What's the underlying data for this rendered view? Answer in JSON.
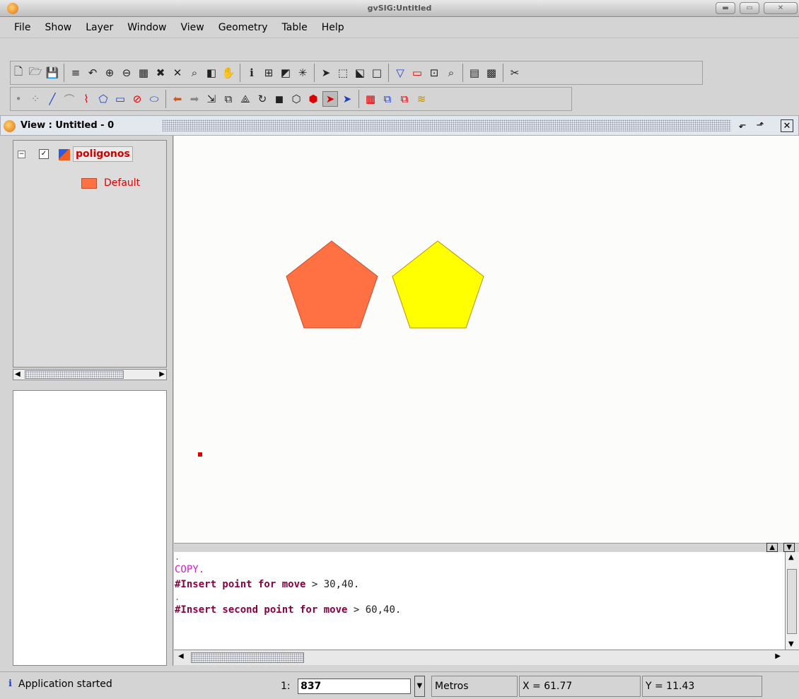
{
  "window": {
    "title": "gvSIG:Untitled"
  },
  "menu": [
    "File",
    "Show",
    "Layer",
    "Window",
    "View",
    "Geometry",
    "Table",
    "Help"
  ],
  "view": {
    "title": "View : Untitled - 0"
  },
  "toc": {
    "layer_name": "poligonos",
    "legend_label": "Default",
    "colors": {
      "layer_fill": "#ff7043",
      "layer_text": "#d00000"
    }
  },
  "map": {
    "shapes": [
      {
        "name": "pentagon-orange",
        "fill": "#ff7043"
      },
      {
        "name": "pentagon-yellow",
        "fill": "#ffff00"
      }
    ]
  },
  "console": {
    "lines": [
      {
        "type": "dot",
        "text": "."
      },
      {
        "type": "copy",
        "text": "COPY."
      },
      {
        "type": "prompt",
        "prompt": "#Insert point for move",
        "value": " > 30,40."
      },
      {
        "type": "dot",
        "text": "."
      },
      {
        "type": "prompt",
        "prompt": "#Insert second point for move",
        "value": " > 60,40."
      }
    ]
  },
  "status": {
    "message": "Application started",
    "scale_prefix": "1:",
    "scale_value": "837",
    "units": "Metros",
    "x": "X = 61.77",
    "y": "Y = 11.43"
  }
}
